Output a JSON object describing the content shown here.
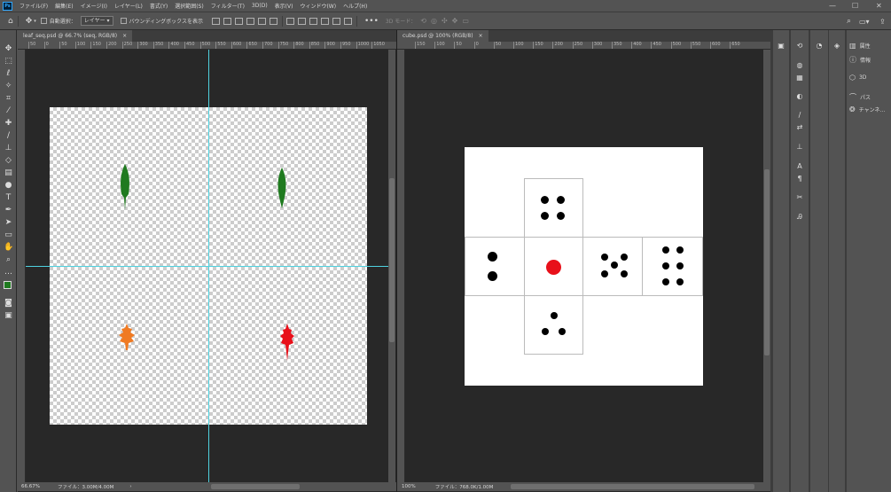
{
  "app": {
    "logo": "Ps"
  },
  "menu": [
    "ファイル(F)",
    "編集(E)",
    "イメージ(I)",
    "レイヤー(L)",
    "書式(Y)",
    "選択範囲(S)",
    "フィルター(T)",
    "3D(D)",
    "表示(V)",
    "ウィンドウ(W)",
    "ヘルプ(H)"
  ],
  "window_controls": [
    "—",
    "☐",
    "✕"
  ],
  "options": {
    "auto_select_label": "自動選択：",
    "layer_select": "レイヤー",
    "bbox_label": "バウンディングボックスを表示",
    "three_d_mode": "3D モード："
  },
  "doc_left": {
    "tab_title": "leaf_seq.psd @ 66.7% (seq, RGB/8)",
    "close": "×",
    "zoom": "66.67%",
    "file_info": "ファイル：3.00M/4.00M",
    "ruler_ticks": [
      "50",
      "0",
      "50",
      "100",
      "150",
      "200",
      "250",
      "300",
      "350",
      "400",
      "450",
      "500",
      "550",
      "600",
      "650",
      "700",
      "750",
      "800",
      "850",
      "900",
      "950",
      "1000",
      "1050"
    ],
    "leaf_colors": {
      "top_left": "#1f7a1f",
      "top_right": "#1f7a1f",
      "bottom_left": "#f07a22",
      "bottom_right": "#e8101a"
    },
    "guide_color": "#4fd2e0"
  },
  "doc_right": {
    "tab_title": "cube.psd @ 100% (RGB/8)",
    "close": "×",
    "zoom": "100%",
    "file_info": "ファイル：768.0K/1.00M",
    "ruler_ticks": [
      "150",
      "100",
      "50",
      "0",
      "50",
      "100",
      "150",
      "200",
      "250",
      "300",
      "350",
      "400",
      "450",
      "500",
      "550",
      "600",
      "650"
    ],
    "center_dot_color": "#e8101a"
  },
  "panels": {
    "items": [
      {
        "icon": "properties-icon",
        "label": "属性"
      },
      {
        "icon": "info-icon",
        "label": "情報"
      },
      {
        "icon": "3d-icon",
        "label": "3D"
      },
      {
        "icon": "paths-icon",
        "label": "パス"
      },
      {
        "icon": "channels-icon",
        "label": "チャンネ..."
      }
    ]
  }
}
